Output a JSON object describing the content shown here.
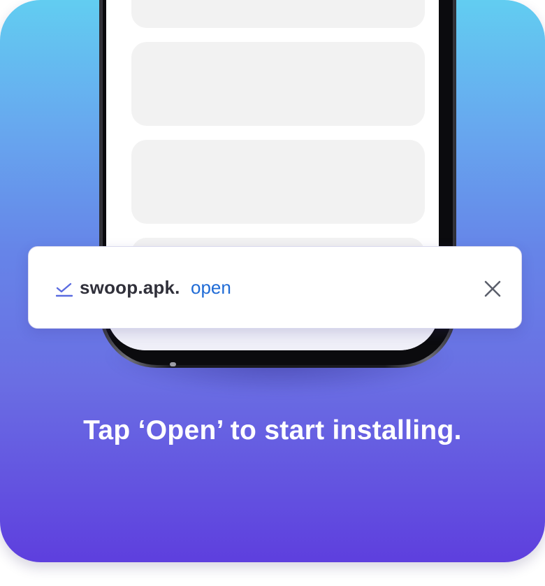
{
  "notification": {
    "filename": "swoop.apk.",
    "action": "open",
    "download_icon": "download-check-icon",
    "close_icon": "close-icon",
    "action_color": "#1f6bd6"
  },
  "caption": "Tap ‘Open’ to start installing.",
  "colors": {
    "background_top": "#62cdf1",
    "background_bottom": "#5e3fde"
  }
}
